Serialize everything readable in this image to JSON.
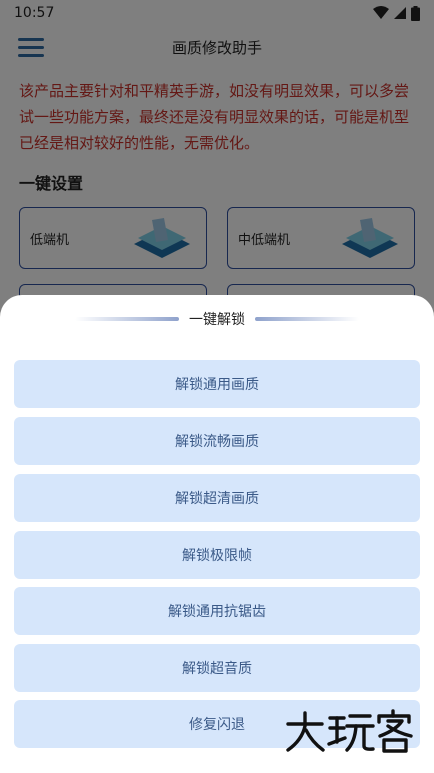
{
  "status_bar": {
    "time": "10:57"
  },
  "app_bar": {
    "title": "画质修改助手"
  },
  "notice": "该产品主要针对和平精英手游，如没有明显效果，可以多尝试一些功能方案，最终还是没有明显效果的话，可能是机型已经是相对较好的性能，无需优化。",
  "section_title": "一键设置",
  "presets": [
    {
      "label": "低端机"
    },
    {
      "label": "中低端机"
    }
  ],
  "sheet": {
    "title": "一键解锁",
    "buttons": [
      "解锁通用画质",
      "解锁流畅画质",
      "解锁超清画质",
      "解锁极限帧",
      "解锁通用抗锯齿",
      "解锁超音质",
      "修复闪退"
    ]
  },
  "watermark": "大玩客",
  "colors": {
    "accent": "#2f6aa3",
    "notice": "#c8312a",
    "button_bg": "#d6e6fb",
    "button_text": "#3b5a88"
  }
}
